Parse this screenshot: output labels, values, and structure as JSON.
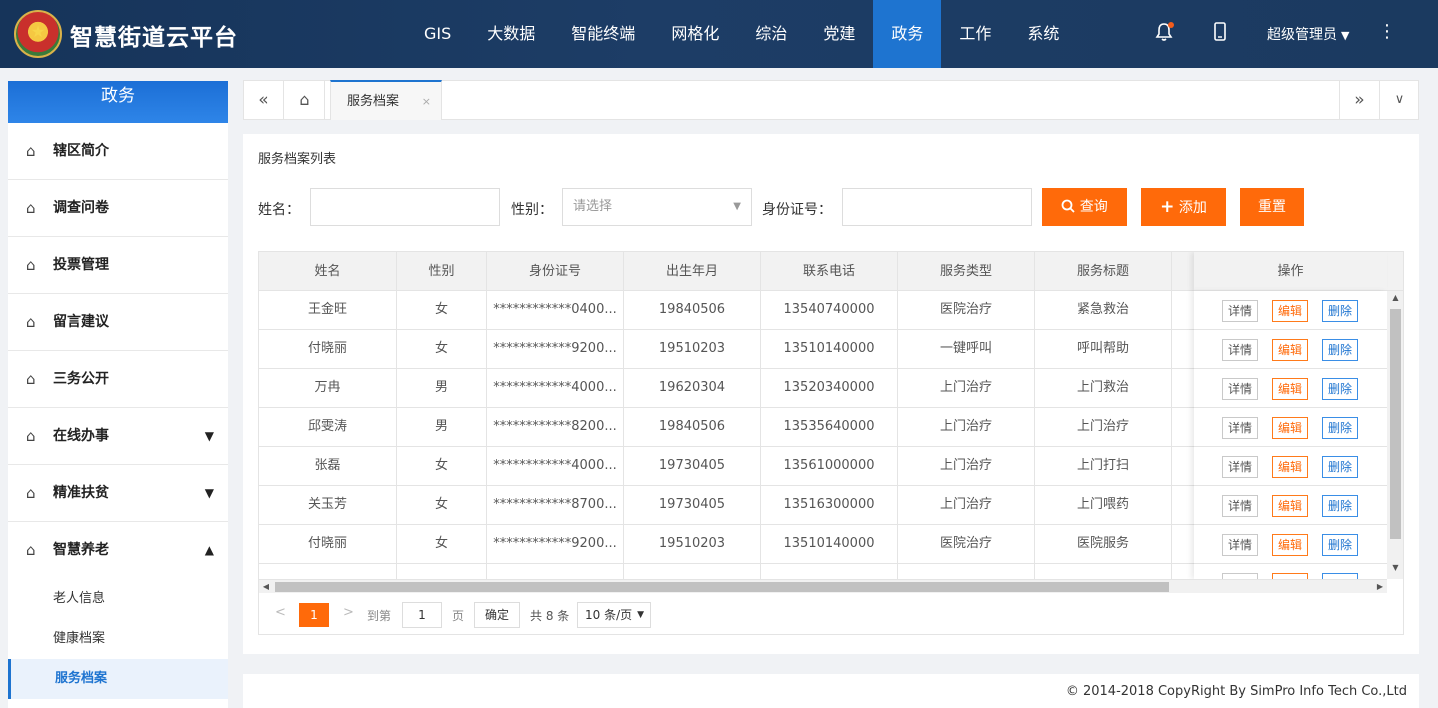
{
  "app": {
    "title": "智慧街道云平台",
    "nav": [
      "GIS",
      "大数据",
      "智能终端",
      "网格化",
      "综治",
      "党建",
      "政务",
      "工作",
      "系统"
    ],
    "active_nav": "政务",
    "user": "超级管理员"
  },
  "sidebar": {
    "title": "政务",
    "items": [
      {
        "label": "辖区简介",
        "arrow": ""
      },
      {
        "label": "调查问卷",
        "arrow": ""
      },
      {
        "label": "投票管理",
        "arrow": ""
      },
      {
        "label": "留言建议",
        "arrow": ""
      },
      {
        "label": "三务公开",
        "arrow": ""
      },
      {
        "label": "在线办事",
        "arrow": "▼"
      },
      {
        "label": "精准扶贫",
        "arrow": "▼"
      },
      {
        "label": "智慧养老",
        "arrow": "▲"
      }
    ],
    "subitems": [
      "老人信息",
      "健康档案",
      "服务档案"
    ],
    "active_sub": "服务档案"
  },
  "tabs": {
    "active": "服务档案",
    "close": "×"
  },
  "panel": {
    "title": "服务档案列表",
    "filters": {
      "name_label": "姓名：",
      "gender_label": "性别：",
      "gender_placeholder": "请选择",
      "id_label": "身份证号："
    },
    "buttons": {
      "search": "查询",
      "add": "添加",
      "reset": "重置"
    }
  },
  "table": {
    "columns": [
      "姓名",
      "性别",
      "身份证号",
      "出生年月",
      "联系电话",
      "服务类型",
      "服务标题"
    ],
    "ops_header": "操作",
    "ops": {
      "detail": "详情",
      "edit": "编辑",
      "delete": "删除"
    },
    "rows": [
      [
        "王金旺",
        "女",
        "************0400...",
        "19840506",
        "13540740000",
        "医院治疗",
        "紧急救治"
      ],
      [
        "付晓丽",
        "女",
        "************9200...",
        "19510203",
        "13510140000",
        "一键呼叫",
        "呼叫帮助"
      ],
      [
        "万冉",
        "男",
        "************4000...",
        "19620304",
        "13520340000",
        "上门治疗",
        "上门救治"
      ],
      [
        "邱雯涛",
        "男",
        "************8200...",
        "19840506",
        "13535640000",
        "上门治疗",
        "上门治疗"
      ],
      [
        "张磊",
        "女",
        "************4000...",
        "19730405",
        "13561000000",
        "上门治疗",
        "上门打扫"
      ],
      [
        "关玉芳",
        "女",
        "************8700...",
        "19730405",
        "13516300000",
        "上门治疗",
        "上门喂药"
      ],
      [
        "付晓丽",
        "女",
        "************9200...",
        "19510203",
        "13510140000",
        "医院治疗",
        "医院服务"
      ]
    ]
  },
  "pager": {
    "current": "1",
    "goto_label": "到第",
    "page_input": "1",
    "page_unit": "页",
    "confirm": "确定",
    "total": "共 8 条",
    "page_size": "10 条/页"
  },
  "footer": {
    "copyright": "© 2014-2018 CopyRight By SimPro Info Tech Co.,Ltd"
  },
  "colors": {
    "header_bg": "#1a3a62",
    "accent_blue": "#1e74d0",
    "accent_orange": "#ff6a0a"
  }
}
